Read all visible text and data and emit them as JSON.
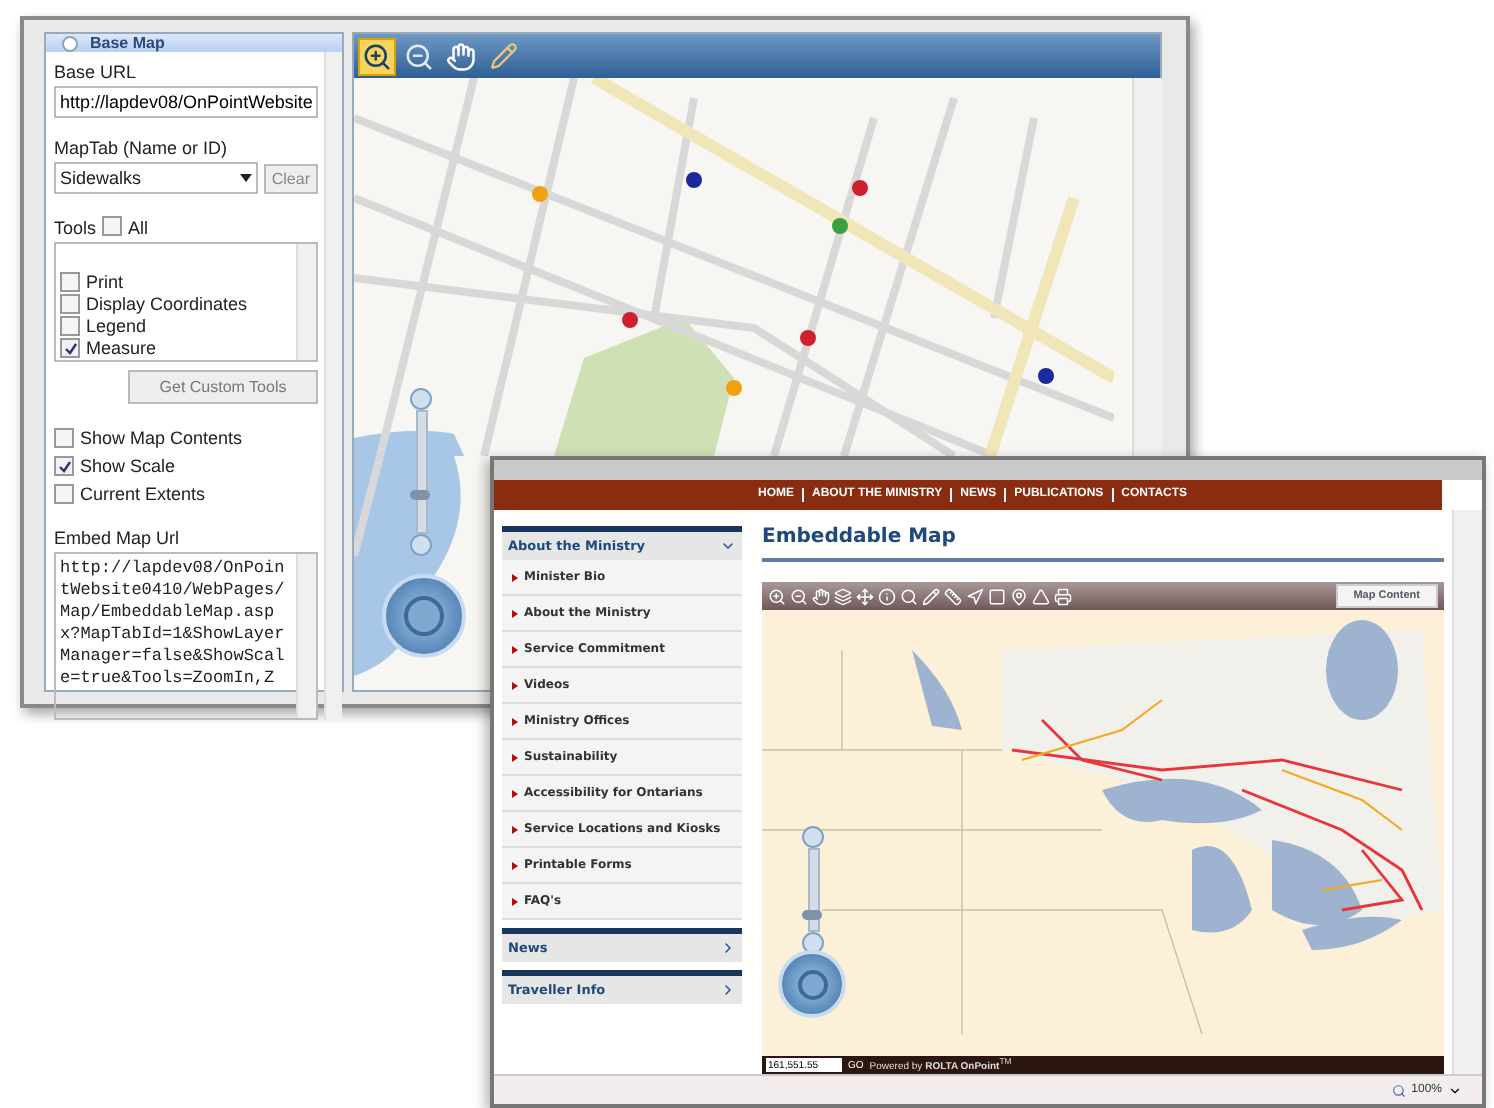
{
  "config_window": {
    "panel_title": "Base Map",
    "base_url": {
      "label": "Base URL",
      "value": "http://lapdev08/OnPointWebsite"
    },
    "map_tab": {
      "label": "MapTab (Name or ID)",
      "value": "Sidewalks",
      "button": "Clear"
    },
    "tools": {
      "label": "Tools",
      "all_label": "All",
      "all_checked": false,
      "items": [
        {
          "label": "Print",
          "checked": false
        },
        {
          "label": "Display Coordinates",
          "checked": false
        },
        {
          "label": "Legend",
          "checked": false
        },
        {
          "label": "Measure",
          "checked": true
        }
      ]
    },
    "custom_tools_button": "Get Custom Tools",
    "options": [
      {
        "label": "Show Map Contents",
        "checked": false
      },
      {
        "label": "Show Scale",
        "checked": true
      },
      {
        "label": "Current Extents",
        "checked": false
      }
    ],
    "embed": {
      "label": "Embed Map Url",
      "value": "http://lapdev08/OnPointWebsite0410/WebPages/Map/EmbeddableMap.aspx?MapTabId=1&ShowLayerManager=false&ShowScale=true&Tools=ZoomIn,Z"
    },
    "map_tools": [
      {
        "kind": "zoom-in",
        "selected": true
      },
      {
        "kind": "zoom-out",
        "selected": false
      },
      {
        "kind": "pan",
        "selected": false
      },
      {
        "kind": "measure",
        "selected": false
      }
    ],
    "zoom_slider": {
      "level": 0.3
    }
  },
  "web_page": {
    "nav_links": [
      "HOME",
      "ABOUT THE MINISTRY",
      "NEWS",
      "PUBLICATIONS",
      "CONTACTS"
    ],
    "sidebar": [
      {
        "title": "About the Ministry",
        "expanded": true,
        "items": [
          "Minister Bio",
          "About the Ministry",
          "Service Commitment",
          "Videos",
          "Ministry Offices",
          "Sustainability",
          "Accessibility for Ontarians",
          "Service Locations and Kiosks",
          "Printable Forms",
          "FAQ's"
        ]
      },
      {
        "title": "News",
        "expanded": false
      },
      {
        "title": "Traveller Info",
        "expanded": false
      }
    ],
    "heading": "Embeddable Map",
    "map_content_button": "Map Content",
    "zoom_slider": {
      "level": 0.15
    },
    "scale_value": "161,551.55",
    "go_button": "GO",
    "powered_by": "Powered by **ROLTA OnPoint**$^{TM}$",
    "zoom_level": "100%"
  }
}
